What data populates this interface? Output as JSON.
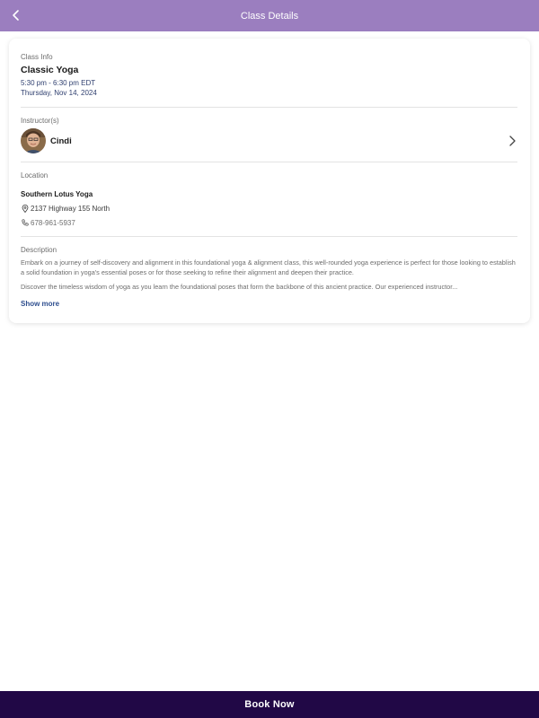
{
  "header": {
    "title": "Class Details",
    "back_icon": "chevron-left-icon",
    "background": "#9b7ebf"
  },
  "class_info": {
    "label": "Class Info",
    "name": "Classic Yoga",
    "time": "5:30 pm - 6:30 pm EDT",
    "date": "Thursday, Nov 14, 2024"
  },
  "instructors": {
    "label": "Instructor(s)",
    "name": "Cindi",
    "chevron_icon": "chevron-right-icon"
  },
  "location": {
    "label": "Location",
    "name": "Southern Lotus Yoga",
    "address": "2137 Highway 155 North",
    "phone": "678-961-5937",
    "address_icon": "map-pin-icon",
    "phone_icon": "phone-icon"
  },
  "description": {
    "label": "Description",
    "paragraph1": "Embark on a journey of self-discovery and alignment in this foundational yoga & alignment class, this well-rounded yoga experience is perfect for those looking to establish a solid foundation in yoga's essential poses or for those seeking to refine their alignment and deepen their practice.",
    "paragraph2": "Discover the timeless wisdom of yoga as you learn the foundational poses that form the backbone of this ancient practice. Our experienced instructor...",
    "show_more": "Show more"
  },
  "footer": {
    "book_label": "Book Now",
    "background": "#210846"
  }
}
